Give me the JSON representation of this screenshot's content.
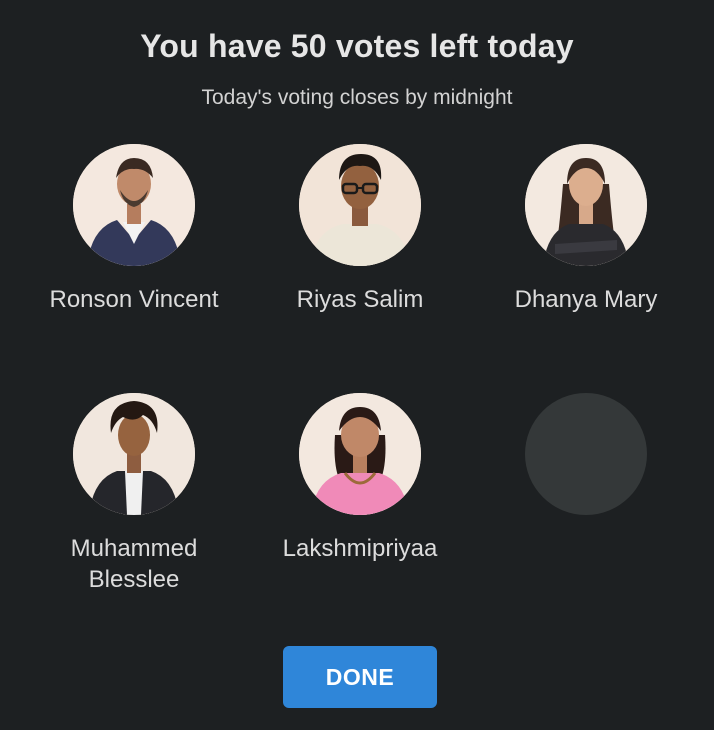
{
  "header": {
    "title": "You have 50 votes left today",
    "subtitle": "Today's voting closes by midnight"
  },
  "contestants": [
    {
      "name": "Ronson Vincent",
      "avatar_icon": "person-photo-icon",
      "outfit_color": "#33395a"
    },
    {
      "name": "Riyas Salim",
      "avatar_icon": "person-photo-icon",
      "outfit_color": "#ece6d8"
    },
    {
      "name": "Dhanya Mary",
      "avatar_icon": "person-photo-icon",
      "outfit_color": "#2a2a2e"
    },
    {
      "name_line1": "Muhammed",
      "name_line2": "Blesslee",
      "avatar_icon": "person-photo-icon",
      "outfit_color": "#25262b"
    },
    {
      "name": "Lakshmipriyaa",
      "avatar_icon": "person-photo-icon",
      "outfit_color": "#f08ab8"
    },
    {
      "name": "",
      "avatar_icon": "empty-avatar-placeholder"
    }
  ],
  "actions": {
    "done_label": "DONE"
  },
  "colors": {
    "background": "#1d2022",
    "accent_button": "#2f86d9",
    "placeholder": "#343839"
  }
}
